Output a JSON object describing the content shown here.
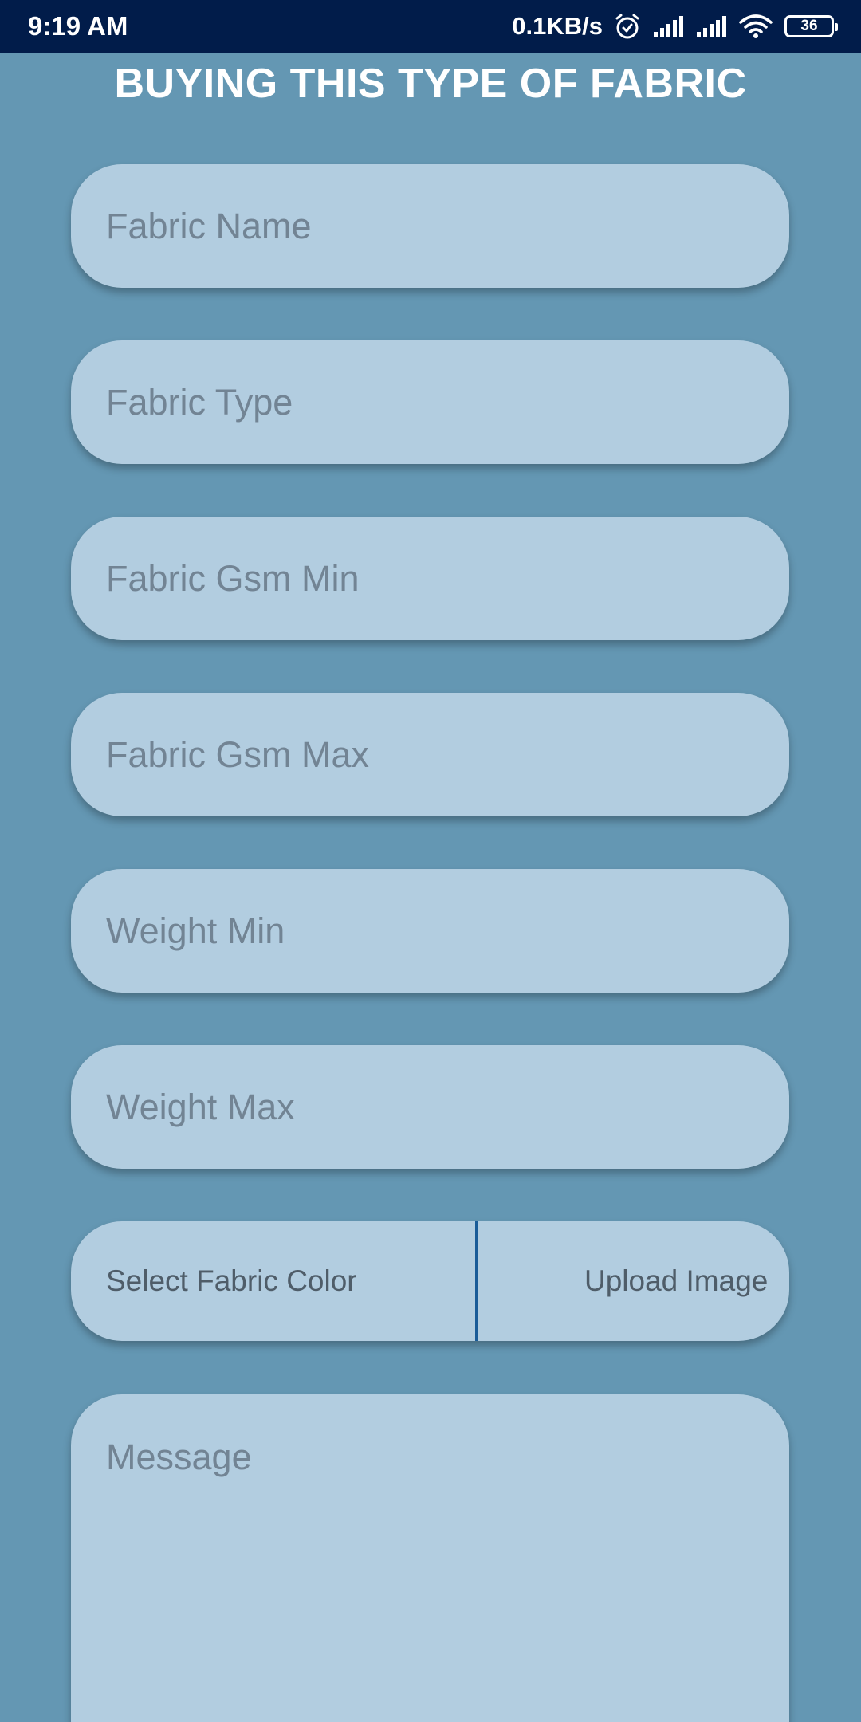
{
  "status_bar": {
    "time": "9:19 AM",
    "net_speed": "0.1KB/s",
    "battery_level": "36",
    "icons": [
      "alarm-icon",
      "signal-icon",
      "signal-icon",
      "wifi-icon",
      "battery-icon"
    ]
  },
  "page": {
    "title": "BUYING THIS TYPE OF FABRIC"
  },
  "form": {
    "fabric_name": {
      "placeholder": "Fabric Name",
      "value": ""
    },
    "fabric_type": {
      "placeholder": "Fabric Type",
      "value": ""
    },
    "gsm_min": {
      "placeholder": "Fabric Gsm Min",
      "value": ""
    },
    "gsm_max": {
      "placeholder": "Fabric Gsm Max",
      "value": ""
    },
    "weight_min": {
      "placeholder": "Weight Min",
      "value": ""
    },
    "weight_max": {
      "placeholder": "Weight Max",
      "value": ""
    },
    "select_color_label": "Select Fabric Color",
    "upload_image_label": "Upload Image",
    "message": {
      "placeholder": "Message",
      "value": ""
    }
  },
  "colors": {
    "status_bar_bg": "#011c4a",
    "background": "#6497b3",
    "field_bg": "#b2cde0",
    "placeholder_text": "#728494",
    "divider": "#1a5c98"
  }
}
